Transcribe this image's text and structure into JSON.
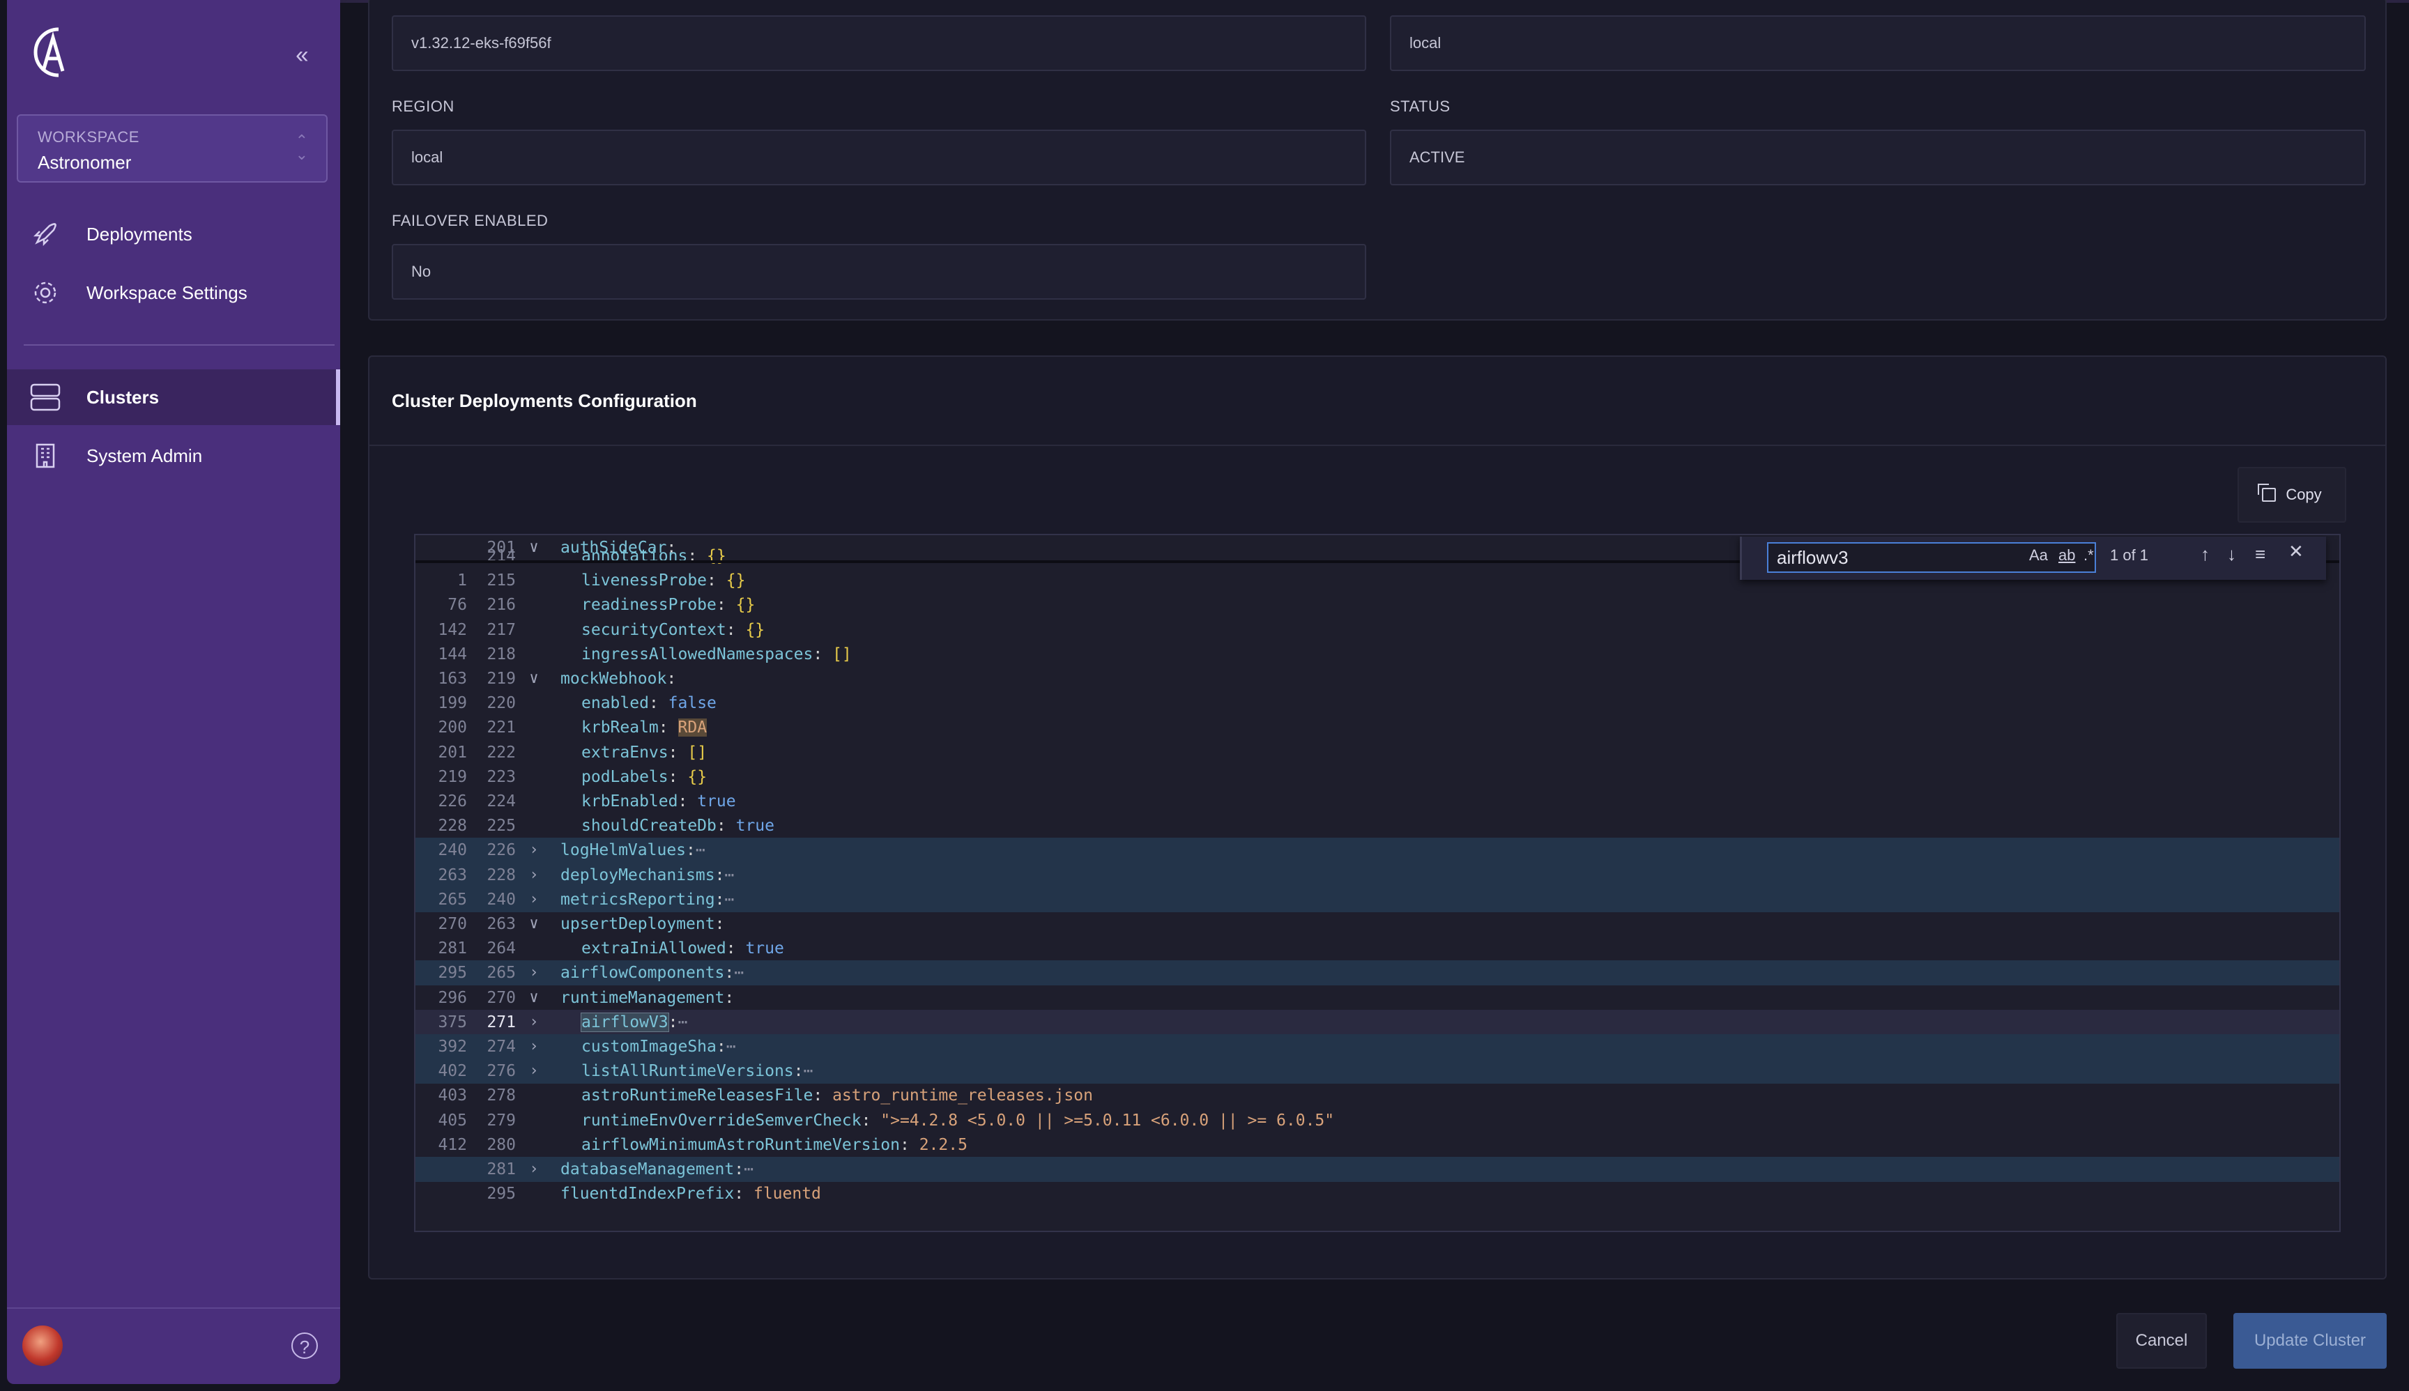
{
  "sidebar": {
    "collapse_icon": "chevrons-left-icon",
    "workspace": {
      "label": "WORKSPACE",
      "value": "Astronomer"
    },
    "items": [
      {
        "label": "Deployments",
        "icon": "rocket-icon"
      },
      {
        "label": "Workspace Settings",
        "icon": "gear-icon"
      },
      {
        "label": "Clusters",
        "icon": "clusters-icon",
        "active": true
      },
      {
        "label": "System Admin",
        "icon": "building-icon"
      }
    ],
    "help": "?"
  },
  "cluster_info": {
    "version_value": "v1.32.12-eks-f69f56f",
    "provider_value": "local",
    "region_label": "REGION",
    "region_value": "local",
    "status_label": "STATUS",
    "status_value": "ACTIVE",
    "failover_label": "FAILOVER ENABLED",
    "failover_value": "No"
  },
  "config": {
    "title": "Cluster Deployments Configuration",
    "copy_label": "Copy"
  },
  "find": {
    "query": "airflowv3",
    "match_case": "Aa",
    "whole_word": "ab",
    "regex": ".*",
    "count": "1 of 1"
  },
  "editor_lines": [
    {
      "a": "",
      "b": "201",
      "fold": "v",
      "indent": 0,
      "key": "authSideCar",
      "val": ""
    },
    {
      "a": "",
      "b": "214",
      "fold": "",
      "indent": 1,
      "key": "annotations",
      "val": "{}",
      "vt": "y"
    },
    {
      "a": "1",
      "b": "215",
      "fold": "",
      "indent": 1,
      "key": "livenessProbe",
      "val": "{}",
      "vt": "y"
    },
    {
      "a": "76",
      "b": "216",
      "fold": "",
      "indent": 1,
      "key": "readinessProbe",
      "val": "{}",
      "vt": "y"
    },
    {
      "a": "142",
      "b": "217",
      "fold": "",
      "indent": 1,
      "key": "securityContext",
      "val": "{}",
      "vt": "y"
    },
    {
      "a": "144",
      "b": "218",
      "fold": "",
      "indent": 1,
      "key": "ingressAllowedNamespaces",
      "val": "[]",
      "vt": "y"
    },
    {
      "a": "163",
      "b": "219",
      "fold": "v",
      "indent": 0,
      "key": "mockWebhook",
      "val": ""
    },
    {
      "a": "199",
      "b": "220",
      "fold": "",
      "indent": 1,
      "key": "enabled",
      "val": "false",
      "vt": "b"
    },
    {
      "a": "200",
      "b": "221",
      "fold": "",
      "indent": 1,
      "key": "krbRealm",
      "val": "RDA",
      "vt": "s"
    },
    {
      "a": "201",
      "b": "222",
      "fold": "",
      "indent": 1,
      "key": "extraEnvs",
      "val": "[]",
      "vt": "y"
    },
    {
      "a": "219",
      "b": "223",
      "fold": "",
      "indent": 1,
      "key": "podLabels",
      "val": "{}",
      "vt": "y"
    },
    {
      "a": "226",
      "b": "224",
      "fold": "",
      "indent": 1,
      "key": "krbEnabled",
      "val": "true",
      "vt": "b"
    },
    {
      "a": "228",
      "b": "225",
      "fold": "",
      "indent": 1,
      "key": "shouldCreateDb",
      "val": "true",
      "vt": "b"
    },
    {
      "a": "240",
      "b": "226",
      "fold": ">",
      "indent": 0,
      "key": "logHelmValues",
      "val": "⋯",
      "vt": "d",
      "hl": true
    },
    {
      "a": "263",
      "b": "228",
      "fold": ">",
      "indent": 0,
      "key": "deployMechanisms",
      "val": "⋯",
      "vt": "d",
      "hl": true
    },
    {
      "a": "265",
      "b": "240",
      "fold": ">",
      "indent": 0,
      "key": "metricsReporting",
      "val": "⋯",
      "vt": "d",
      "hl": true
    },
    {
      "a": "270",
      "b": "263",
      "fold": "v",
      "indent": 0,
      "key": "upsertDeployment",
      "val": ""
    },
    {
      "a": "281",
      "b": "264",
      "fold": "",
      "indent": 1,
      "key": "extraIniAllowed",
      "val": "true",
      "vt": "b"
    },
    {
      "a": "295",
      "b": "265",
      "fold": ">",
      "indent": 0,
      "key": "airflowComponents",
      "val": "⋯",
      "vt": "d",
      "hl": true
    },
    {
      "a": "296",
      "b": "270",
      "fold": "v",
      "indent": 0,
      "key": "runtimeManagement",
      "val": ""
    },
    {
      "a": "375",
      "b": "271",
      "fold": ">",
      "indent": 1,
      "key": "airflowV3",
      "val": "⋯",
      "vt": "d",
      "cur": true
    },
    {
      "a": "392",
      "b": "274",
      "fold": ">",
      "indent": 1,
      "key": "customImageSha",
      "val": "⋯",
      "vt": "d",
      "hl": true
    },
    {
      "a": "402",
      "b": "276",
      "fold": ">",
      "indent": 1,
      "key": "listAllRuntimeVersions",
      "val": "⋯",
      "vt": "d",
      "hl": true
    },
    {
      "a": "403",
      "b": "278",
      "fold": "",
      "indent": 1,
      "key": "astroRuntimeReleasesFile",
      "val": "astro_runtime_releases.json",
      "vt": "s"
    },
    {
      "a": "405",
      "b": "279",
      "fold": "",
      "indent": 1,
      "key": "runtimeEnvOverrideSemverCheck",
      "val": "\">=4.2.8 <5.0.0 || >=5.0.11 <6.0.0 || >= 6.0.5\"",
      "vt": "s"
    },
    {
      "a": "412",
      "b": "280",
      "fold": "",
      "indent": 1,
      "key": "airflowMinimumAstroRuntimeVersion",
      "val": "2.2.5",
      "vt": "s"
    },
    {
      "a": "",
      "b": "281",
      "fold": ">",
      "indent": 0,
      "key": "databaseManagement",
      "val": "⋯",
      "vt": "d",
      "hl": true
    },
    {
      "a": "",
      "b": "295",
      "fold": "",
      "indent": 0,
      "key": "fluentdIndexPrefix",
      "val": "fluentd",
      "vt": "s"
    }
  ],
  "footer": {
    "cancel_label": "Cancel",
    "update_label": "Update Cluster"
  }
}
